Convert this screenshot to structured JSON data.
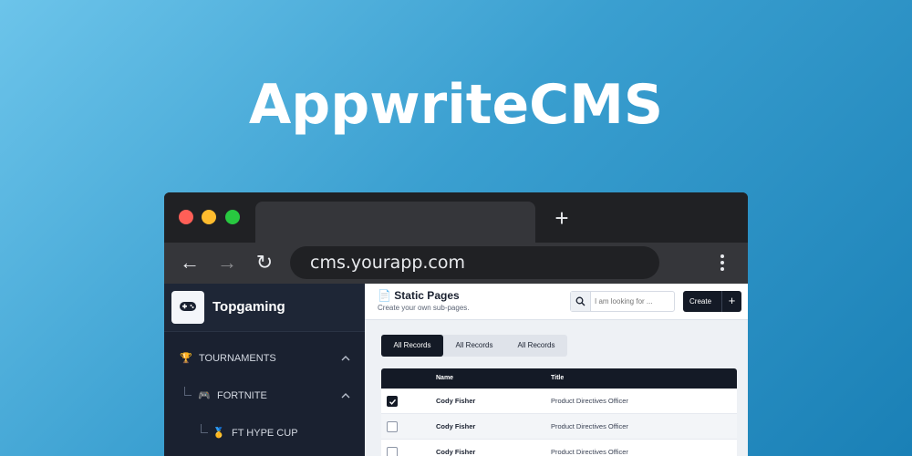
{
  "hero": {
    "title": "AppwriteCMS"
  },
  "browser": {
    "new_tab_glyph": "+",
    "back_glyph": "←",
    "forward_glyph": "→",
    "reload_glyph": "↻",
    "url": "cms.yourapp.com",
    "traffic_lights": {
      "close": "#ff5f57",
      "minimize": "#febc2e",
      "maximize": "#28c840"
    }
  },
  "sidebar": {
    "brand": {
      "name": "Topgaming",
      "logo_icon": "gamepad-icon"
    },
    "items": [
      {
        "label": "TOURNAMENTS",
        "icon": "🏆",
        "icon_name": "trophy-icon",
        "expanded": true
      },
      {
        "label": "FORTNITE",
        "icon": "🎮",
        "icon_name": "gamepad-icon",
        "expanded": true
      },
      {
        "label": "FT HYPE CUP",
        "icon": "🥇",
        "icon_name": "medal-icon"
      }
    ]
  },
  "main": {
    "title": "Static Pages",
    "title_icon": "📄",
    "subtitle": "Create your own sub-pages.",
    "search": {
      "placeholder": "I am looking for ..."
    },
    "create_label": "Create",
    "create_plus": "+",
    "tabs": [
      {
        "label": "All Records",
        "active": true
      },
      {
        "label": "All Records",
        "active": false
      },
      {
        "label": "All Records",
        "active": false
      }
    ],
    "table": {
      "columns": [
        "Name",
        "Title"
      ],
      "rows": [
        {
          "name": "Cody Fisher",
          "title": "Product Directives Officer",
          "checked": true
        },
        {
          "name": "Cody Fisher",
          "title": "Product Directives Officer",
          "checked": false
        },
        {
          "name": "Cody Fisher",
          "title": "Product Directives Officer",
          "checked": false
        }
      ]
    }
  },
  "colors": {
    "accent_dark": "#141a26",
    "sidebar_bg": "#1a2130",
    "background_gradient": [
      "#6cc4ea",
      "#1a80b6"
    ]
  }
}
